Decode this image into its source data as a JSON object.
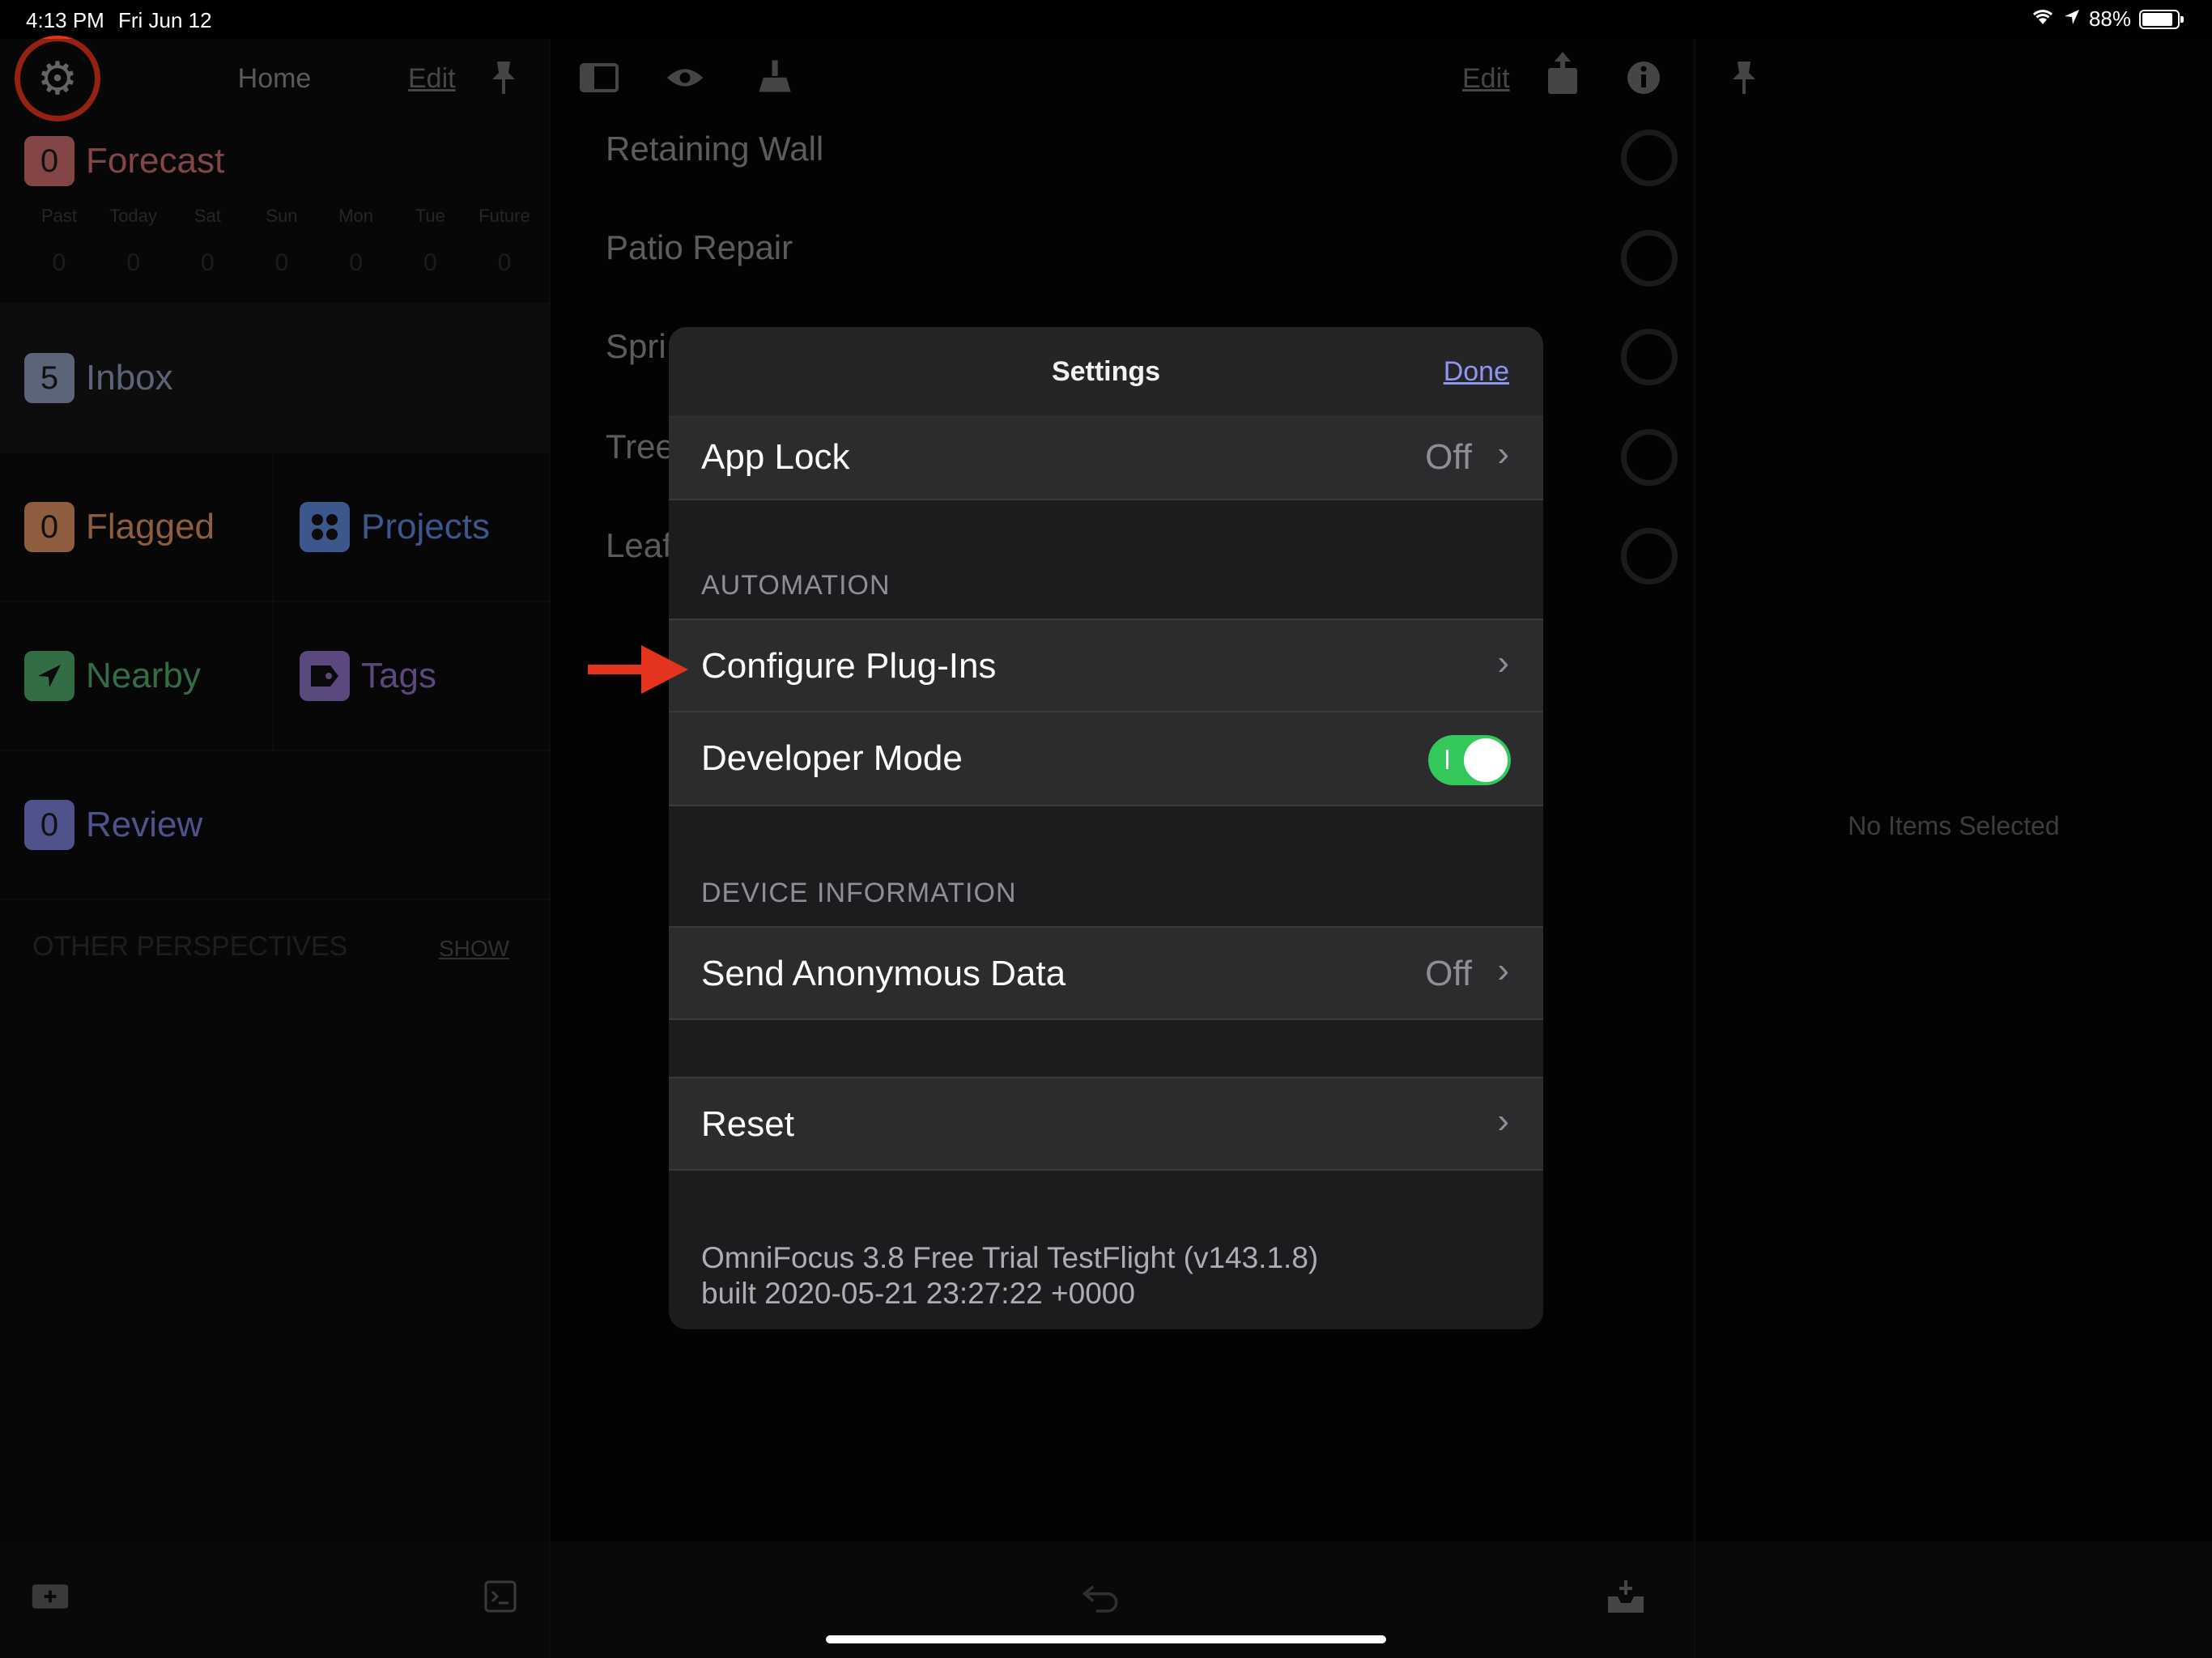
{
  "status_bar": {
    "time": "4:13 PM",
    "date": "Fri Jun 12",
    "battery": "88%",
    "icons": [
      "wifi-icon",
      "location-icon",
      "battery-icon"
    ]
  },
  "left_panel": {
    "title": "Home",
    "edit_label": "Edit",
    "perspectives": {
      "forecast": {
        "label": "Forecast",
        "count": "0",
        "color": "#c96b6b"
      },
      "inbox": {
        "label": "Inbox",
        "count": "5",
        "color": "#8c9ab8"
      },
      "flagged": {
        "label": "Flagged",
        "count": "0",
        "color": "#d99060"
      },
      "projects": {
        "label": "Projects",
        "color": "#5b86d6"
      },
      "nearby": {
        "label": "Nearby",
        "color": "#4ea86a"
      },
      "tags": {
        "label": "Tags",
        "color": "#8b6fc4"
      },
      "review": {
        "label": "Review",
        "count": "0",
        "color": "#7c7fd6"
      }
    },
    "forecast_days": [
      {
        "day": "Past",
        "value": "0"
      },
      {
        "day": "Today",
        "value": "0"
      },
      {
        "day": "Sat",
        "value": "0"
      },
      {
        "day": "Sun",
        "value": "0"
      },
      {
        "day": "Mon",
        "value": "0"
      },
      {
        "day": "Tue",
        "value": "0"
      },
      {
        "day": "Future",
        "value": "0"
      }
    ],
    "other_perspectives": "OTHER PERSPECTIVES",
    "show_label": "SHOW"
  },
  "middle_panel": {
    "edit_label": "Edit",
    "tasks": [
      "Retaining Wall",
      "Patio Repair",
      "Spri",
      "Tree",
      "Leaf"
    ]
  },
  "right_panel": {
    "empty_text": "No Items Selected"
  },
  "settings_modal": {
    "title": "Settings",
    "done_label": "Done",
    "app_lock": {
      "label": "App Lock",
      "value": "Off"
    },
    "automation_header": "AUTOMATION",
    "configure_plugins": {
      "label": "Configure Plug-Ins"
    },
    "developer_mode": {
      "label": "Developer Mode",
      "enabled": true
    },
    "device_info_header": "DEVICE INFORMATION",
    "send_anonymous_data": {
      "label": "Send Anonymous Data",
      "value": "Off"
    },
    "reset": {
      "label": "Reset"
    },
    "version_line1": "OmniFocus 3.8 Free Trial TestFlight (v143.1.8)",
    "version_line2": "built 2020-05-21 23:27:22 +0000"
  },
  "colors": {
    "accent_link": "#8e97f0",
    "toggle_on": "#34c759",
    "highlight_annotation": "#e5341e"
  }
}
